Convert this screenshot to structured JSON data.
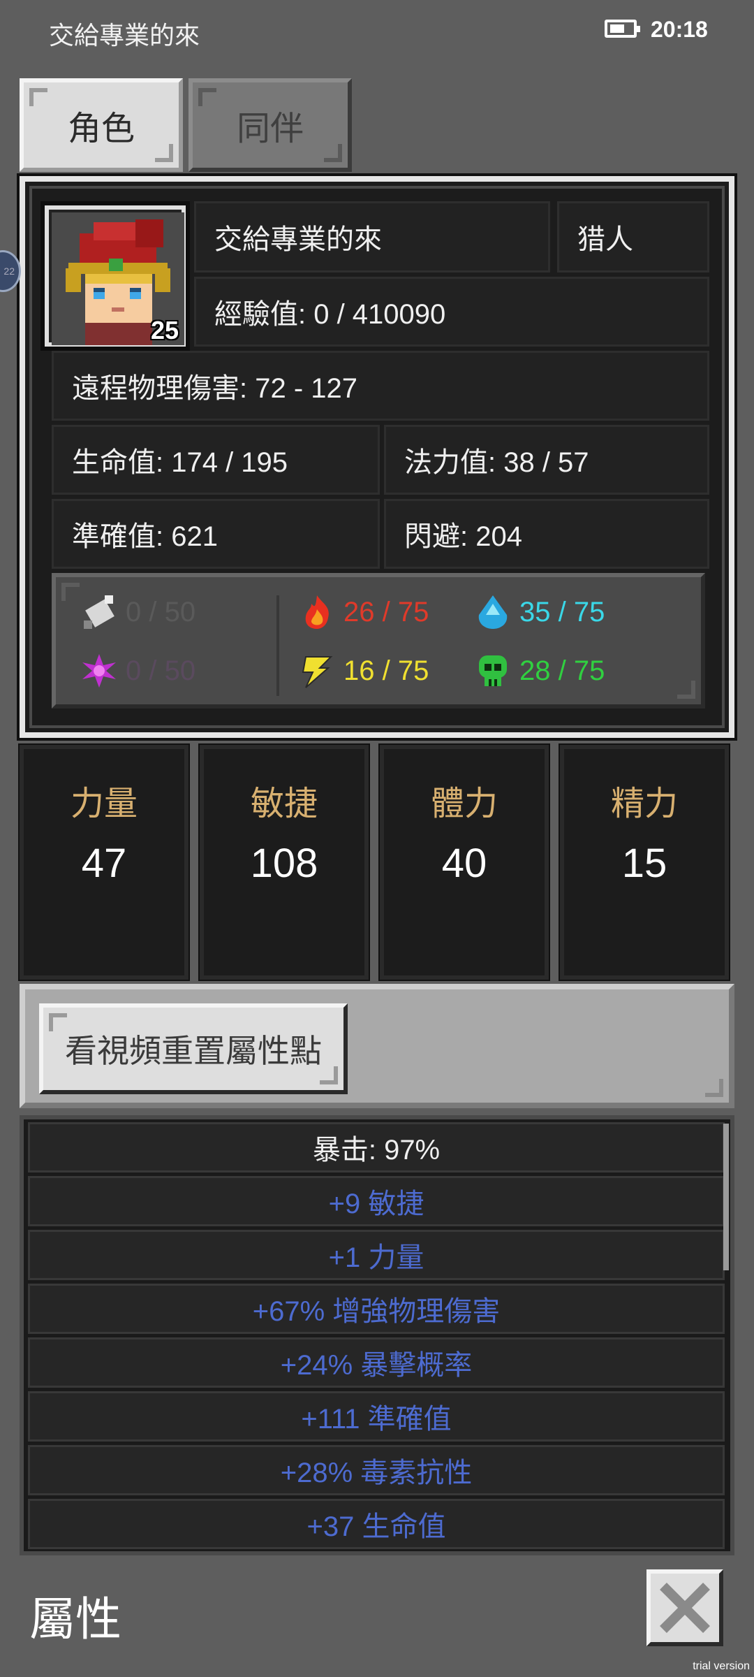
{
  "status_bar": {
    "app_title": "交給專業的來",
    "time": "20:18"
  },
  "tabs": [
    {
      "label": "角色",
      "active": true
    },
    {
      "label": "同伴",
      "active": false
    }
  ],
  "character": {
    "name": "交給專業的來",
    "class": "猎人",
    "level": "25",
    "experience": "經驗值: 0 / 410090",
    "damage": "遠程物理傷害: 72 - 127",
    "hp": "生命值: 174 / 195",
    "mp": "法力值: 38 / 57",
    "accuracy": "準確值: 621",
    "evasion": "閃避: 204"
  },
  "resistances": [
    {
      "icon": "physical-shield-icon",
      "value": "0 / 50",
      "color": "#5a5a5a"
    },
    {
      "icon": "magic-star-icon",
      "value": "0 / 50",
      "color": "#5a4a5e"
    },
    {
      "icon": "fire-icon",
      "value": "26 / 75",
      "color": "#e03a2a"
    },
    {
      "icon": "lightning-icon",
      "value": "16 / 75",
      "color": "#f0e030"
    },
    {
      "icon": "water-drop-icon",
      "value": "35 / 75",
      "color": "#3ad8e8"
    },
    {
      "icon": "poison-skull-icon",
      "value": "28 / 75",
      "color": "#30d040"
    }
  ],
  "attributes": [
    {
      "label": "力量",
      "value": "47"
    },
    {
      "label": "敏捷",
      "value": "108"
    },
    {
      "label": "體力",
      "value": "40"
    },
    {
      "label": "精力",
      "value": "15"
    }
  ],
  "reset_button_label": "看視頻重置屬性點",
  "bonuses": {
    "header": "暴击: 97%",
    "items": [
      "+9 敏捷",
      "+1 力量",
      "+67% 增強物理傷害",
      "+24% 暴擊概率",
      "+111 準確值",
      "+28% 毒素抗性",
      "+37 生命值"
    ]
  },
  "footer": {
    "title": "屬性"
  },
  "side_badge": "22",
  "watermark": "trial version",
  "colors": {
    "attribute_label": "#d8b070",
    "bonus_text": "#4d6bd0"
  }
}
